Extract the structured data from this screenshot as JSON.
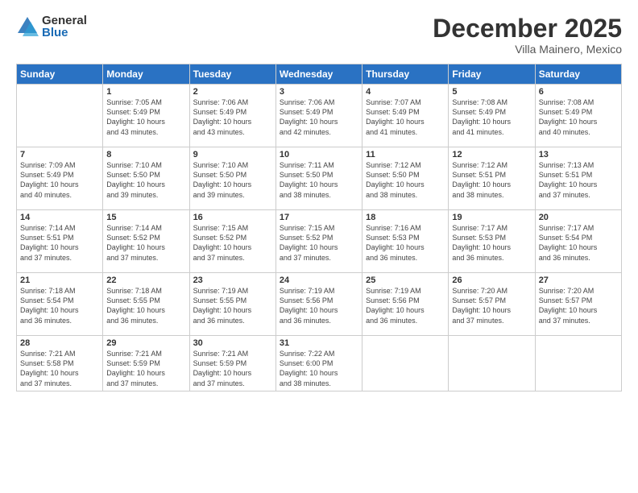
{
  "logo": {
    "general": "General",
    "blue": "Blue"
  },
  "title": "December 2025",
  "subtitle": "Villa Mainero, Mexico",
  "headers": [
    "Sunday",
    "Monday",
    "Tuesday",
    "Wednesday",
    "Thursday",
    "Friday",
    "Saturday"
  ],
  "weeks": [
    [
      {
        "day": "",
        "info": ""
      },
      {
        "day": "1",
        "info": "Sunrise: 7:05 AM\nSunset: 5:49 PM\nDaylight: 10 hours\nand 43 minutes."
      },
      {
        "day": "2",
        "info": "Sunrise: 7:06 AM\nSunset: 5:49 PM\nDaylight: 10 hours\nand 43 minutes."
      },
      {
        "day": "3",
        "info": "Sunrise: 7:06 AM\nSunset: 5:49 PM\nDaylight: 10 hours\nand 42 minutes."
      },
      {
        "day": "4",
        "info": "Sunrise: 7:07 AM\nSunset: 5:49 PM\nDaylight: 10 hours\nand 41 minutes."
      },
      {
        "day": "5",
        "info": "Sunrise: 7:08 AM\nSunset: 5:49 PM\nDaylight: 10 hours\nand 41 minutes."
      },
      {
        "day": "6",
        "info": "Sunrise: 7:08 AM\nSunset: 5:49 PM\nDaylight: 10 hours\nand 40 minutes."
      }
    ],
    [
      {
        "day": "7",
        "info": "Sunrise: 7:09 AM\nSunset: 5:49 PM\nDaylight: 10 hours\nand 40 minutes."
      },
      {
        "day": "8",
        "info": "Sunrise: 7:10 AM\nSunset: 5:50 PM\nDaylight: 10 hours\nand 39 minutes."
      },
      {
        "day": "9",
        "info": "Sunrise: 7:10 AM\nSunset: 5:50 PM\nDaylight: 10 hours\nand 39 minutes."
      },
      {
        "day": "10",
        "info": "Sunrise: 7:11 AM\nSunset: 5:50 PM\nDaylight: 10 hours\nand 38 minutes."
      },
      {
        "day": "11",
        "info": "Sunrise: 7:12 AM\nSunset: 5:50 PM\nDaylight: 10 hours\nand 38 minutes."
      },
      {
        "day": "12",
        "info": "Sunrise: 7:12 AM\nSunset: 5:51 PM\nDaylight: 10 hours\nand 38 minutes."
      },
      {
        "day": "13",
        "info": "Sunrise: 7:13 AM\nSunset: 5:51 PM\nDaylight: 10 hours\nand 37 minutes."
      }
    ],
    [
      {
        "day": "14",
        "info": "Sunrise: 7:14 AM\nSunset: 5:51 PM\nDaylight: 10 hours\nand 37 minutes."
      },
      {
        "day": "15",
        "info": "Sunrise: 7:14 AM\nSunset: 5:52 PM\nDaylight: 10 hours\nand 37 minutes."
      },
      {
        "day": "16",
        "info": "Sunrise: 7:15 AM\nSunset: 5:52 PM\nDaylight: 10 hours\nand 37 minutes."
      },
      {
        "day": "17",
        "info": "Sunrise: 7:15 AM\nSunset: 5:52 PM\nDaylight: 10 hours\nand 37 minutes."
      },
      {
        "day": "18",
        "info": "Sunrise: 7:16 AM\nSunset: 5:53 PM\nDaylight: 10 hours\nand 36 minutes."
      },
      {
        "day": "19",
        "info": "Sunrise: 7:17 AM\nSunset: 5:53 PM\nDaylight: 10 hours\nand 36 minutes."
      },
      {
        "day": "20",
        "info": "Sunrise: 7:17 AM\nSunset: 5:54 PM\nDaylight: 10 hours\nand 36 minutes."
      }
    ],
    [
      {
        "day": "21",
        "info": "Sunrise: 7:18 AM\nSunset: 5:54 PM\nDaylight: 10 hours\nand 36 minutes."
      },
      {
        "day": "22",
        "info": "Sunrise: 7:18 AM\nSunset: 5:55 PM\nDaylight: 10 hours\nand 36 minutes."
      },
      {
        "day": "23",
        "info": "Sunrise: 7:19 AM\nSunset: 5:55 PM\nDaylight: 10 hours\nand 36 minutes."
      },
      {
        "day": "24",
        "info": "Sunrise: 7:19 AM\nSunset: 5:56 PM\nDaylight: 10 hours\nand 36 minutes."
      },
      {
        "day": "25",
        "info": "Sunrise: 7:19 AM\nSunset: 5:56 PM\nDaylight: 10 hours\nand 36 minutes."
      },
      {
        "day": "26",
        "info": "Sunrise: 7:20 AM\nSunset: 5:57 PM\nDaylight: 10 hours\nand 37 minutes."
      },
      {
        "day": "27",
        "info": "Sunrise: 7:20 AM\nSunset: 5:57 PM\nDaylight: 10 hours\nand 37 minutes."
      }
    ],
    [
      {
        "day": "28",
        "info": "Sunrise: 7:21 AM\nSunset: 5:58 PM\nDaylight: 10 hours\nand 37 minutes."
      },
      {
        "day": "29",
        "info": "Sunrise: 7:21 AM\nSunset: 5:59 PM\nDaylight: 10 hours\nand 37 minutes."
      },
      {
        "day": "30",
        "info": "Sunrise: 7:21 AM\nSunset: 5:59 PM\nDaylight: 10 hours\nand 37 minutes."
      },
      {
        "day": "31",
        "info": "Sunrise: 7:22 AM\nSunset: 6:00 PM\nDaylight: 10 hours\nand 38 minutes."
      },
      {
        "day": "",
        "info": ""
      },
      {
        "day": "",
        "info": ""
      },
      {
        "day": "",
        "info": ""
      }
    ]
  ]
}
